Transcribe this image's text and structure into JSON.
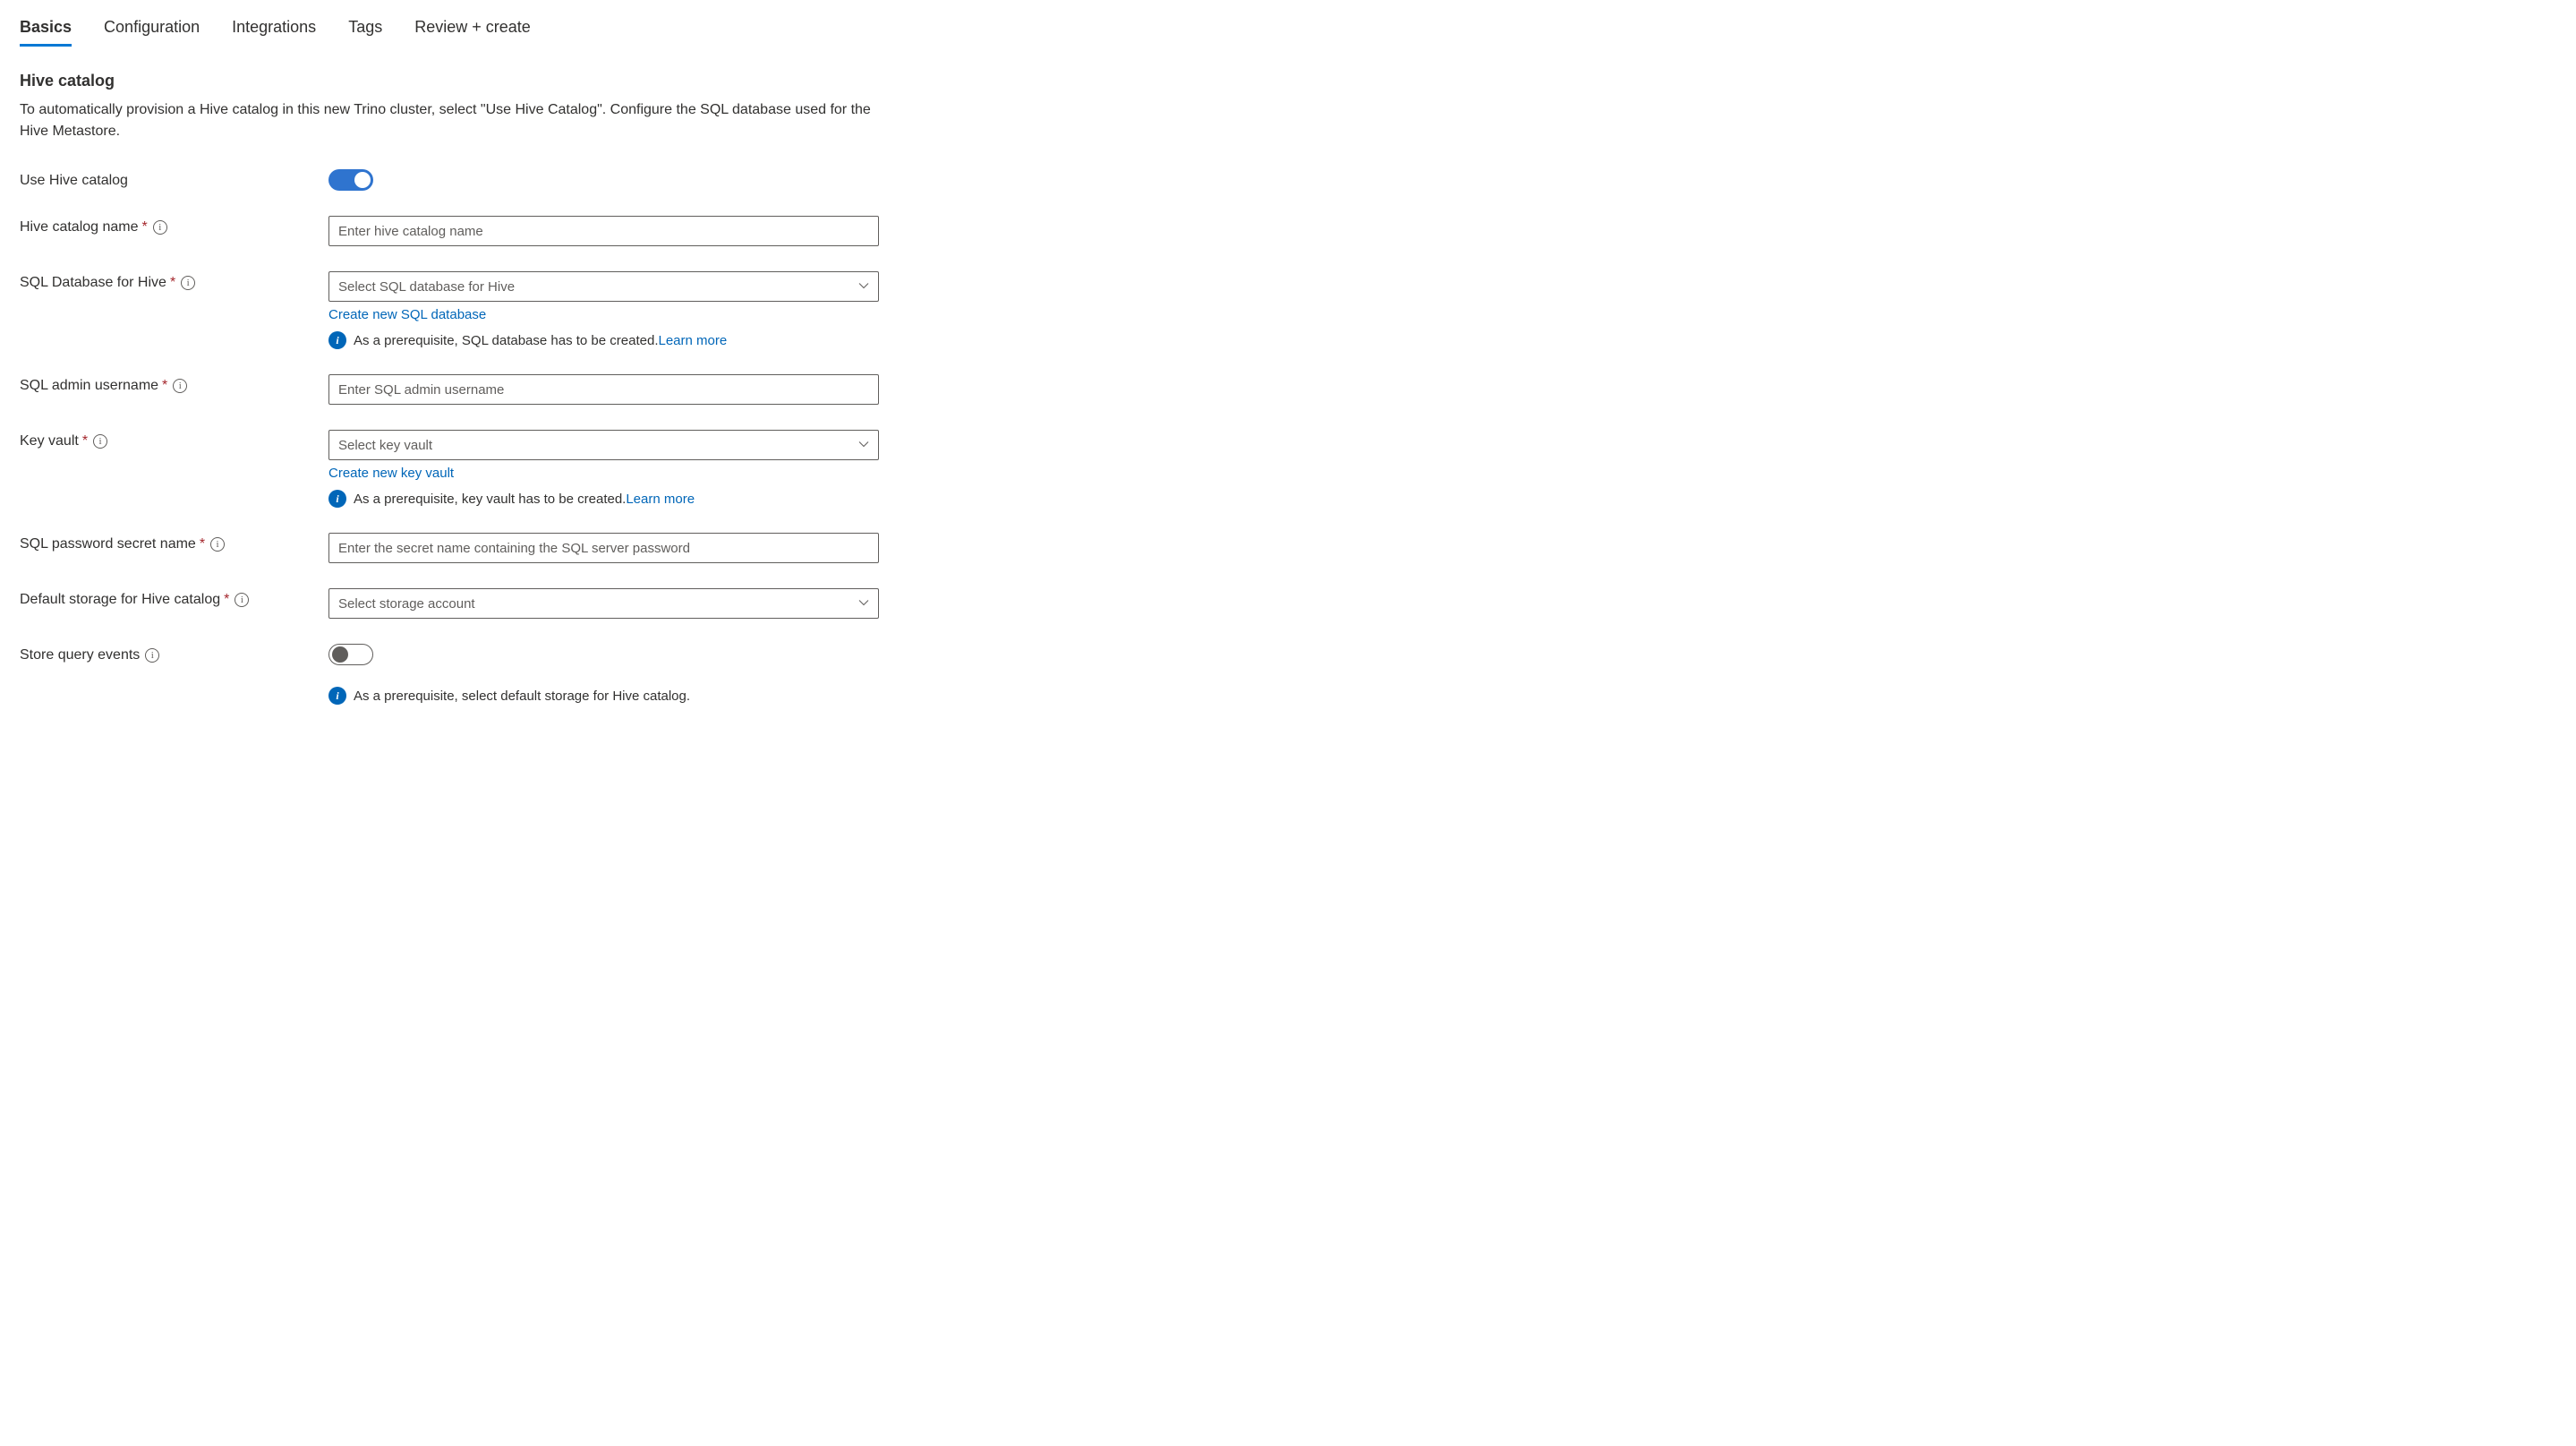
{
  "tabs": {
    "items": [
      {
        "label": "Basics",
        "active": true
      },
      {
        "label": "Configuration",
        "active": false
      },
      {
        "label": "Integrations",
        "active": false
      },
      {
        "label": "Tags",
        "active": false
      },
      {
        "label": "Review + create",
        "active": false
      }
    ]
  },
  "section": {
    "title": "Hive catalog",
    "description": "To automatically provision a Hive catalog in this new Trino cluster, select \"Use Hive Catalog\". Configure the SQL database used for the Hive Metastore."
  },
  "form": {
    "use_hive_catalog": {
      "label": "Use Hive catalog",
      "value": true
    },
    "hive_catalog_name": {
      "label": "Hive catalog name",
      "placeholder": "Enter hive catalog name",
      "required": true
    },
    "sql_database": {
      "label": "SQL Database for Hive",
      "placeholder": "Select SQL database for Hive",
      "required": true,
      "create_link": "Create new SQL database",
      "info_prefix": "As a prerequisite, SQL database has to be created.",
      "learn_more": "Learn more"
    },
    "sql_admin_username": {
      "label": "SQL admin username",
      "placeholder": "Enter SQL admin username",
      "required": true
    },
    "key_vault": {
      "label": "Key vault",
      "placeholder": "Select key vault",
      "required": true,
      "create_link": "Create new key vault",
      "info_prefix": "As a prerequisite, key vault has to be created.",
      "learn_more": "Learn more"
    },
    "sql_password_secret": {
      "label": "SQL password secret name",
      "placeholder": "Enter the secret name containing the SQL server password",
      "required": true
    },
    "default_storage": {
      "label": "Default storage for Hive catalog",
      "placeholder": "Select storage account",
      "required": true
    },
    "store_query_events": {
      "label": "Store query events",
      "value": false,
      "info": "As a prerequisite, select default storage for Hive catalog."
    }
  }
}
